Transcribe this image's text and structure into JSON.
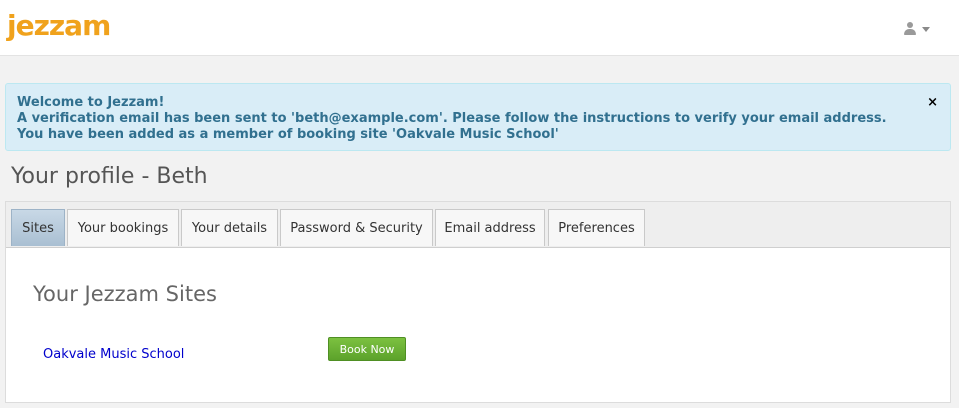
{
  "header": {
    "logo_text": "jezzam",
    "user_icon": "user-icon",
    "menu_icon": "chevron-down-icon"
  },
  "alert": {
    "line1": "Welcome to Jezzam!",
    "line2": "A verification email has been sent to 'beth@example.com'. Please follow the instructions to verify your email address.",
    "line3": "You have been added as a member of booking site 'Oakvale Music School'",
    "close_label": "×",
    "close_icon": "close-icon"
  },
  "page": {
    "title": "Your profile - Beth"
  },
  "tabs": [
    {
      "label": "Sites",
      "active": true
    },
    {
      "label": "Your bookings",
      "active": false
    },
    {
      "label": "Your details",
      "active": false
    },
    {
      "label": "Password & Security",
      "active": false
    },
    {
      "label": "Email address",
      "active": false
    },
    {
      "label": "Preferences",
      "active": false
    }
  ],
  "sites": {
    "heading": "Your Jezzam Sites",
    "items": [
      {
        "name": "Oakvale Music School",
        "button_label": "Book Now"
      }
    ]
  },
  "colors": {
    "brand": "#f0a21c",
    "alert_bg": "#d9edf7",
    "alert_text": "#31708f",
    "link": "#0000cc",
    "button_green": "#6db336"
  }
}
